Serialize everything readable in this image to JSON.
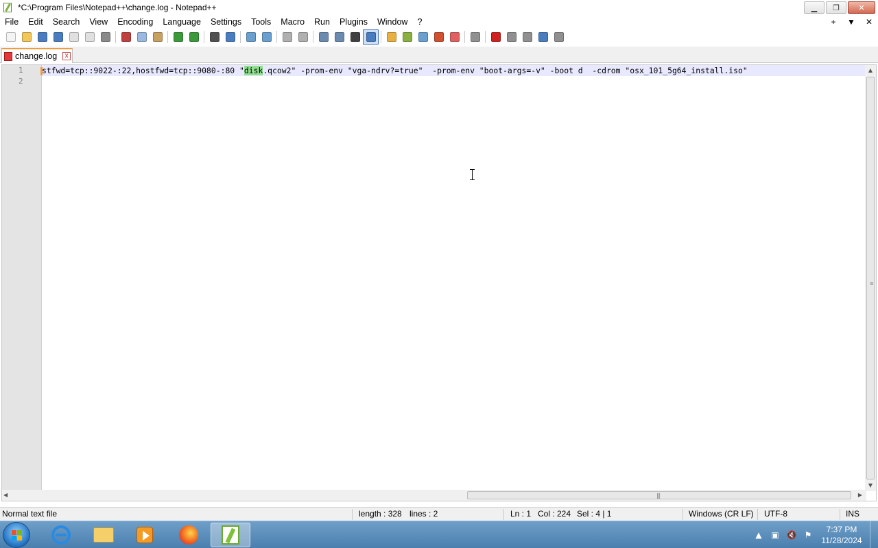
{
  "window": {
    "title": "*C:\\Program Files\\Notepad++\\change.log - Notepad++",
    "controls": {
      "minimize": "▁",
      "restore": "❐",
      "close": "✕"
    }
  },
  "menu": {
    "items": [
      "File",
      "Edit",
      "Search",
      "View",
      "Encoding",
      "Language",
      "Settings",
      "Tools",
      "Macro",
      "Run",
      "Plugins",
      "Window",
      "?"
    ],
    "right": {
      "add": "+",
      "dropdown": "▼",
      "close": "✕"
    }
  },
  "toolbar": {
    "icons": [
      {
        "name": "new-file-icon",
        "color": "#f4f4f4"
      },
      {
        "name": "open-file-icon",
        "color": "#f2c75a"
      },
      {
        "name": "save-icon",
        "color": "#4a7cc0"
      },
      {
        "name": "save-all-icon",
        "color": "#4a7cc0"
      },
      {
        "name": "close-icon",
        "color": "#e0e0e0"
      },
      {
        "name": "close-all-icon",
        "color": "#e0e0e0"
      },
      {
        "name": "print-icon",
        "color": "#8a8a8a"
      },
      {
        "name": "sep"
      },
      {
        "name": "cut-icon",
        "color": "#c04040"
      },
      {
        "name": "copy-icon",
        "color": "#9ab8e0"
      },
      {
        "name": "paste-icon",
        "color": "#c8a060"
      },
      {
        "name": "sep"
      },
      {
        "name": "undo-icon",
        "color": "#3a9a3a"
      },
      {
        "name": "redo-icon",
        "color": "#3a9a3a"
      },
      {
        "name": "sep"
      },
      {
        "name": "find-icon",
        "color": "#505050"
      },
      {
        "name": "replace-icon",
        "color": "#4a7cc0"
      },
      {
        "name": "sep"
      },
      {
        "name": "zoom-in-icon",
        "color": "#6aa0d0"
      },
      {
        "name": "zoom-out-icon",
        "color": "#6aa0d0"
      },
      {
        "name": "sep"
      },
      {
        "name": "sync-vertical-icon",
        "color": "#b0b0b0"
      },
      {
        "name": "sync-horizontal-icon",
        "color": "#b0b0b0"
      },
      {
        "name": "sep"
      },
      {
        "name": "word-wrap-icon",
        "color": "#6a8ab0"
      },
      {
        "name": "show-all-chars-icon",
        "color": "#6a8ab0"
      },
      {
        "name": "chevron-down-icon",
        "color": "#404040"
      },
      {
        "name": "indent-guide-icon",
        "color": "#4a7cc0",
        "active": true
      },
      {
        "name": "sep"
      },
      {
        "name": "define-language-icon",
        "color": "#e8b040"
      },
      {
        "name": "doc-map-icon",
        "color": "#8ab040"
      },
      {
        "name": "function-list-icon",
        "color": "#6aa0d0"
      },
      {
        "name": "folder-workspace-icon",
        "color": "#d05030"
      },
      {
        "name": "doc-list-icon",
        "color": "#e06060"
      },
      {
        "name": "sep"
      },
      {
        "name": "monitoring-eye-icon",
        "color": "#909090"
      },
      {
        "name": "sep"
      },
      {
        "name": "record-macro-icon",
        "color": "#d02020"
      },
      {
        "name": "stop-macro-icon",
        "color": "#909090"
      },
      {
        "name": "play-macro-icon",
        "color": "#909090"
      },
      {
        "name": "run-macro-multiple-icon",
        "color": "#4a7cc0"
      },
      {
        "name": "save-macro-icon",
        "color": "#909090"
      }
    ]
  },
  "tabs": [
    {
      "label": "change.log",
      "close": "x"
    }
  ],
  "editor": {
    "line_numbers": [
      "1",
      "2"
    ],
    "line1": {
      "before": "stfwd=tcp::9022-:22,hostfwd=tcp::9080-:80 \"",
      "highlight": "disk",
      "after": ".qcow2\" -prom-env \"vga-ndrv?=true\"  -prom-env \"boot-args=-v\" -boot d  -cdrom \"osx_101_5g64_install.iso\""
    },
    "line2": "",
    "colors": {
      "highlight": "#8fdf8f",
      "current_line": "#e8e8ff",
      "caret": "#f29a3c",
      "gutter": "#e4e4e4"
    }
  },
  "statusbar": {
    "file_type": "Normal text file",
    "length": "length : 328",
    "lines": "lines : 2",
    "ln": "Ln : 1",
    "col": "Col : 224",
    "sel": "Sel : 4 | 1",
    "eol": "Windows (CR LF)",
    "encoding": "UTF-8",
    "mode": "INS"
  },
  "taskbar": {
    "apps": [
      "internet-explorer",
      "file-explorer",
      "media-player",
      "firefox",
      "notepad-plus-plus"
    ],
    "clock_time": "7:37 PM",
    "clock_date": "11/28/2024",
    "tray": {
      "chevron": "▲",
      "network": "▣",
      "volume": "🔇",
      "flag": "⚑"
    }
  }
}
